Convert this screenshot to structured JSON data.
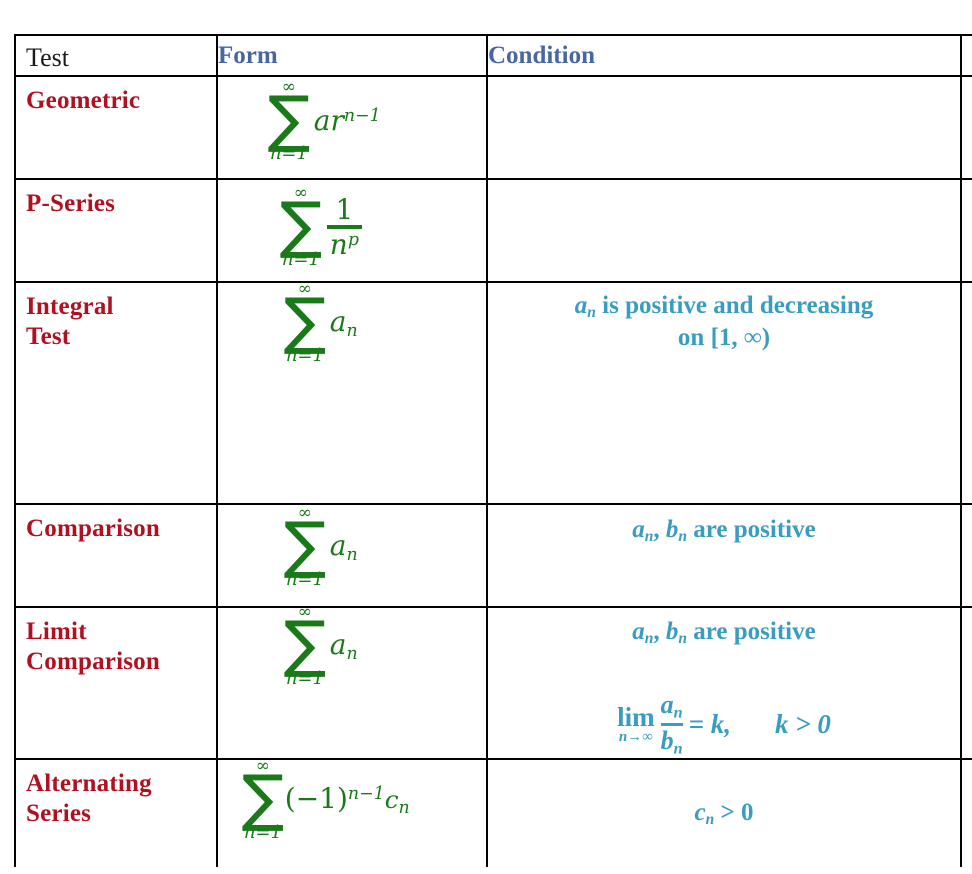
{
  "table": {
    "headers": {
      "test": "Test",
      "form": "Form",
      "condition": "Condition",
      "extra": ""
    },
    "rows": [
      {
        "test": "Geometric",
        "form": {
          "sum_upper": "∞",
          "sum_lower": "n=1",
          "summand_base": "ar",
          "summand_exponent": "n−1",
          "plain": "∑ n=1 to ∞  ar^(n−1)"
        },
        "condition": {
          "lines": [],
          "plain": ""
        }
      },
      {
        "test": "P-Series",
        "form": {
          "sum_upper": "∞",
          "sum_lower": "n=1",
          "fraction_numerator": "1",
          "fraction_denominator_base": "n",
          "fraction_denominator_exponent": "p",
          "plain": "∑ n=1 to ∞  1/n^p"
        },
        "condition": {
          "lines": [],
          "plain": ""
        }
      },
      {
        "test": "Integral Test",
        "test_line1": "Integral",
        "test_line2": "Test",
        "form": {
          "sum_upper": "∞",
          "sum_lower": "n=1",
          "summand_base": "a",
          "summand_subscript": "n",
          "plain": "∑ n=1 to ∞  aₙ"
        },
        "condition": {
          "lines": [
            "aₙ is positive and decreasing",
            "on [1, ∞)"
          ],
          "line1_prefix_var": "a",
          "line1_prefix_sub": "n",
          "line1_text": " is positive and decreasing",
          "line2_text": "on [1, ∞)",
          "plain": "aₙ is positive and decreasing on [1, ∞)"
        }
      },
      {
        "test": "Comparison",
        "form": {
          "sum_upper": "∞",
          "sum_lower": "n=1",
          "summand_base": "a",
          "summand_subscript": "n",
          "plain": "∑ n=1 to ∞  aₙ"
        },
        "condition": {
          "var1": "a",
          "var1_sub": "n",
          "var2": "b",
          "var2_sub": "n",
          "tail": " are positive",
          "plain": "aₙ, bₙ are positive"
        }
      },
      {
        "test": "Limit Comparison",
        "test_line1": "Limit",
        "test_line2": "Comparison",
        "form": {
          "sum_upper": "∞",
          "sum_lower": "n=1",
          "summand_base": "a",
          "summand_subscript": "n",
          "plain": "∑ n=1 to ∞  aₙ"
        },
        "condition": {
          "var1": "a",
          "var1_sub": "n",
          "var2": "b",
          "var2_sub": "n",
          "tail": " are positive",
          "plain": "aₙ, bₙ are positive",
          "limit_op": "lim",
          "limit_sub": "n→∞",
          "limit_num_base": "a",
          "limit_num_sub": "n",
          "limit_den_base": "b",
          "limit_den_sub": "n",
          "limit_equals": "= k,",
          "limit_constraint": "k > 0",
          "limit_plain": "lim n→∞ aₙ/bₙ = k,  k > 0"
        }
      },
      {
        "test": "Alternating Series",
        "test_line1": "Alternating",
        "test_line2": "Series",
        "form": {
          "sum_upper": "∞",
          "sum_lower": "n=1",
          "summand_factor": "(−1)",
          "summand_exponent": "n−1",
          "summand_base": "c",
          "summand_subscript": "n",
          "plain": "∑ n=1 to ∞  (−1)^(n−1) cₙ"
        },
        "condition": {
          "var1": "c",
          "var1_sub": "n",
          "tail": " > 0",
          "plain": "cₙ > 0"
        }
      }
    ]
  },
  "colors": {
    "header_blue": "#47689e",
    "header_black": "#1a1a1a",
    "test_red": "#b01020",
    "form_green": "#1a7a1a",
    "condition_teal": "#3a9cc0",
    "border_black": "#000000",
    "background": "#ffffff"
  }
}
